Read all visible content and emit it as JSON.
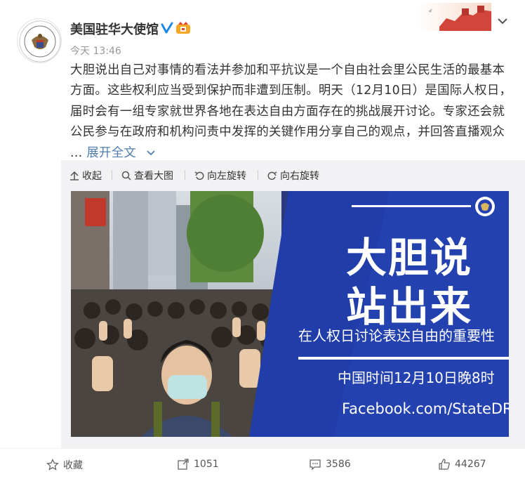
{
  "header": {
    "account_name": "美国驻华大使馆",
    "timestamp": "今天 13:46",
    "verified_icon": "verified-badge-icon",
    "vip_icon": "vip-badge-icon"
  },
  "post": {
    "lines": [
      "大胆说出自己对事情的看法并参加和平抗议是一个自由社会里公民生活的最基本",
      "方面。这些权利应当受到保护而非遭到压制。明天（12月10日）是国际人权日，",
      "届时会有一组专家就世界各地在表达自由方面存在的挑战展开讨论。专家还会就",
      "公民参与在政府和机构问责中发挥的关键作用分享自己的观点，并回答直播观众"
    ],
    "ellipsis": "...",
    "expand_label": "展开全文",
    "expand_icon": "chevron-down-icon"
  },
  "media_toolbar": {
    "collapse": "收起",
    "view_large": "查看大图",
    "rotate_left": "向左旋转",
    "rotate_right": "向右旋转"
  },
  "poster": {
    "line1": "大胆说",
    "line2": "站出来",
    "subtitle": "在人权日讨论表达自由的重要性",
    "time": "中国时间12月10日晚8时",
    "url": "Facebook.com/StateDRL",
    "colors": {
      "panel": "#1f3aa6",
      "accent": "#ffffff"
    }
  },
  "actions": {
    "favorite": "收藏",
    "repost_count": "1051",
    "comment_count": "3586",
    "like_count": "44267"
  },
  "colors": {
    "link": "#507daf",
    "muted": "#999999",
    "text": "#333333"
  }
}
